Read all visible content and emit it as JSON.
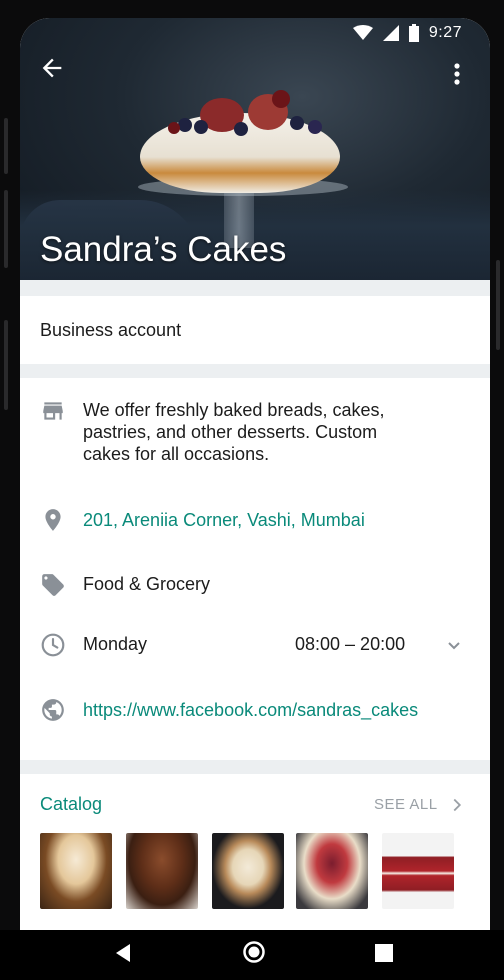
{
  "status_bar": {
    "time": "9:27"
  },
  "header": {
    "title": "Sandra’s Cakes"
  },
  "account": {
    "type_label": "Business account"
  },
  "details": {
    "description": "We offer freshly baked breads, cakes, pastries, and other desserts. Custom cakes for all occasions.",
    "address": "201, Areniia Corner, Vashi, Mumbai",
    "category": "Food & Grocery",
    "hours_day": "Monday",
    "hours_time": "08:00 – 20:00",
    "website": "https://www.facebook.com/sandras_cakes"
  },
  "catalog": {
    "title": "Catalog",
    "see_all": "SEE ALL"
  },
  "colors": {
    "accent_teal": "#0a8a7a",
    "icon_gray": "#8a9097",
    "separator": "#eceff1"
  }
}
